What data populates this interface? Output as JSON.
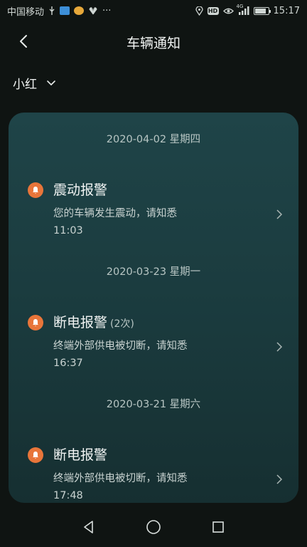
{
  "status_bar": {
    "carrier": "中国移动",
    "time": "15:17",
    "signal_label": "4G",
    "hd_label": "HD",
    "battery_level": 0.85
  },
  "header": {
    "title": "车辆通知"
  },
  "vehicle_selector": {
    "name": "小红"
  },
  "groups": [
    {
      "date": "2020-04-02 星期四",
      "item": {
        "title": "震动报警",
        "count": "",
        "desc": "您的车辆发生震动，请知悉",
        "time": "11:03"
      }
    },
    {
      "date": "2020-03-23 星期一",
      "item": {
        "title": "断电报警",
        "count": "(2次)",
        "desc": "终端外部供电被切断，请知悉",
        "time": "16:37"
      }
    },
    {
      "date": "2020-03-21 星期六",
      "item": {
        "title": "断电报警",
        "count": "",
        "desc": "终端外部供电被切断，请知悉",
        "time": "17:48"
      }
    }
  ],
  "colors": {
    "accent": "#e8753a",
    "card": "#1f4448",
    "background": "#0f1412"
  }
}
